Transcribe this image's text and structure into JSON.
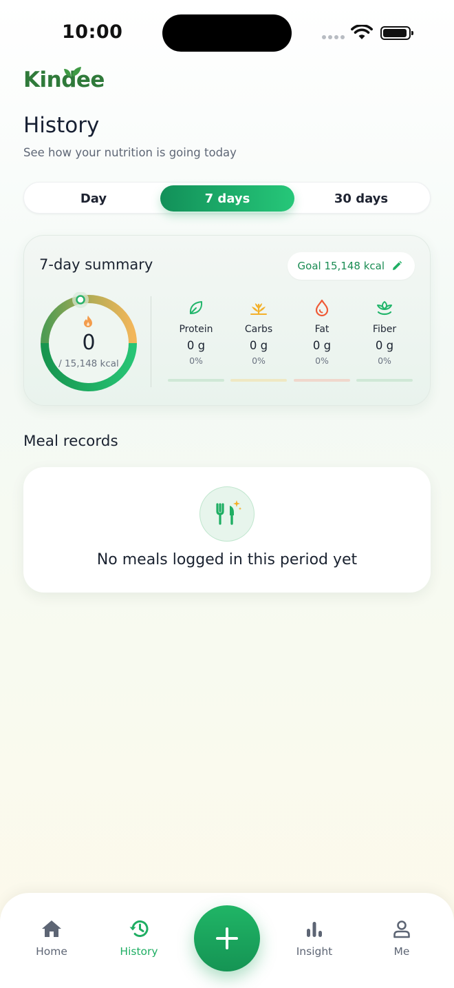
{
  "status_bar": {
    "time": "10:00"
  },
  "brand": {
    "name": "Kindee",
    "color": "#2f7a3a"
  },
  "header": {
    "title": "History",
    "subtitle": "See how your nutrition is going today"
  },
  "range_tabs": [
    {
      "label": "Day",
      "selected": false
    },
    {
      "label": "7 days",
      "selected": true
    },
    {
      "label": "30 days",
      "selected": false
    }
  ],
  "summary": {
    "title": "7-day summary",
    "goal_label": "Goal 15,148 kcal",
    "calories_value": "0",
    "calories_goal": "/ 15,148 kcal",
    "progress_fraction": 0,
    "macros": [
      {
        "name": "Protein",
        "amount": "0 g",
        "percent": "0%",
        "icon": "leaf-icon",
        "color": "#22b56b"
      },
      {
        "name": "Carbs",
        "amount": "0 g",
        "percent": "0%",
        "icon": "wheat-icon",
        "color": "#f3b02a"
      },
      {
        "name": "Fat",
        "amount": "0 g",
        "percent": "0%",
        "icon": "drop-icon",
        "color": "#ef5a36"
      },
      {
        "name": "Fiber",
        "amount": "0 g",
        "percent": "0%",
        "icon": "sprout-icon",
        "color": "#22b56b"
      }
    ]
  },
  "meals": {
    "section_title": "Meal records",
    "empty_text": "No meals logged in this period yet"
  },
  "nav": {
    "items": [
      {
        "label": "Home",
        "icon": "home-icon",
        "active": false
      },
      {
        "label": "History",
        "icon": "history-icon",
        "active": true
      },
      {
        "label": "Insight",
        "icon": "bar-chart-icon",
        "active": false
      },
      {
        "label": "Me",
        "icon": "person-icon",
        "active": false
      }
    ],
    "add_icon": "plus-icon"
  },
  "colors": {
    "accent": "#1fae63",
    "accent_dark": "#129059"
  }
}
